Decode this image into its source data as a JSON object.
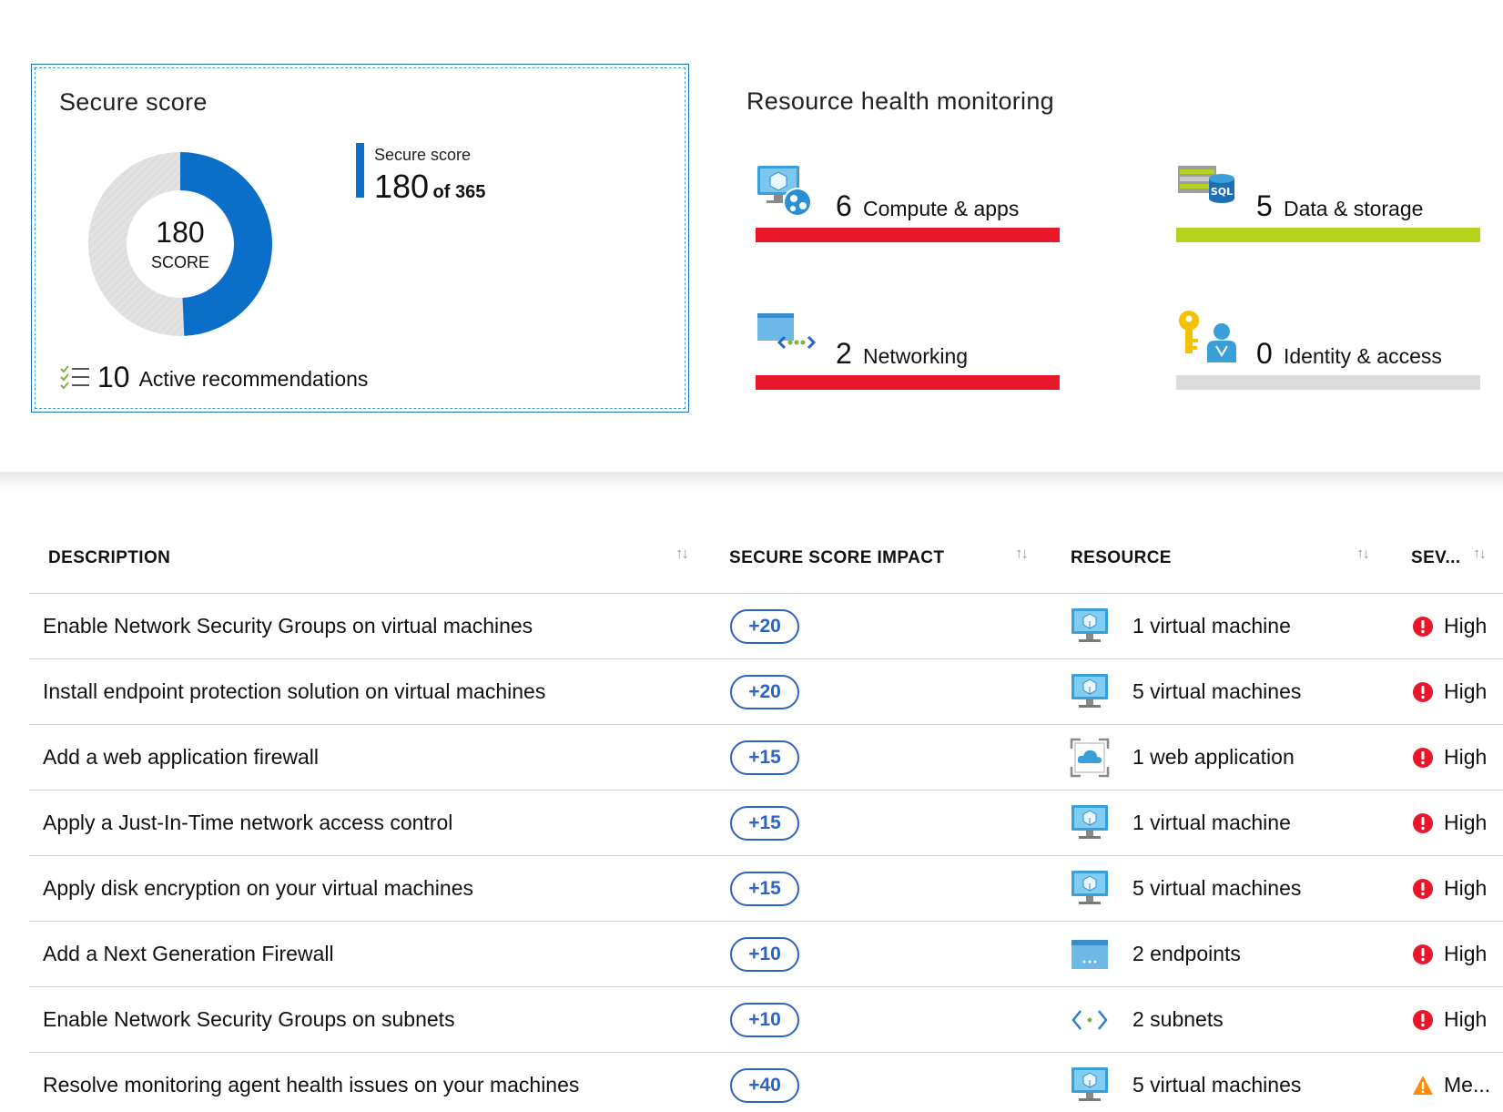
{
  "secure_score": {
    "title": "Secure score",
    "score": "180",
    "score_caption": "SCORE",
    "score_value": 180,
    "score_max": 365,
    "legend_label": "Secure score",
    "legend_value": "180",
    "legend_of": "of 365",
    "active_count": "10",
    "active_label": "Active recommendations",
    "colors": {
      "score": "#0b6ec9",
      "remaining": "#dadada"
    }
  },
  "resource_health": {
    "title": "Resource health monitoring",
    "tiles": [
      {
        "count": "6",
        "label": "Compute & apps",
        "bar_color": "#e8182a",
        "icon": "compute-apps-icon"
      },
      {
        "count": "5",
        "label": "Data & storage",
        "bar_color": "#b6d21c",
        "icon": "data-storage-icon"
      },
      {
        "count": "2",
        "label": "Networking",
        "bar_color": "#e8182a",
        "icon": "networking-icon"
      },
      {
        "count": "0",
        "label": "Identity & access",
        "bar_color": "#dcdcdc",
        "icon": "identity-access-icon"
      }
    ]
  },
  "table": {
    "headers": {
      "description": "DESCRIPTION",
      "impact": "SECURE SCORE IMPACT",
      "resource": "RESOURCE",
      "severity": "SEV..."
    },
    "rows": [
      {
        "description": "Enable Network Security Groups on virtual machines",
        "impact": "+20",
        "resource": "1 virtual machine",
        "resource_icon": "virtual-machine-icon",
        "severity": "High",
        "severity_icon": "high-severity-icon"
      },
      {
        "description": "Install endpoint protection solution on virtual machines",
        "impact": "+20",
        "resource": "5 virtual machines",
        "resource_icon": "virtual-machine-icon",
        "severity": "High",
        "severity_icon": "high-severity-icon"
      },
      {
        "description": "Add a web application firewall",
        "impact": "+15",
        "resource": "1 web application",
        "resource_icon": "web-application-icon",
        "severity": "High",
        "severity_icon": "high-severity-icon"
      },
      {
        "description": "Apply a Just-In-Time network access control",
        "impact": "+15",
        "resource": "1 virtual machine",
        "resource_icon": "virtual-machine-icon",
        "severity": "High",
        "severity_icon": "high-severity-icon"
      },
      {
        "description": "Apply disk encryption on your virtual machines",
        "impact": "+15",
        "resource": "5 virtual machines",
        "resource_icon": "virtual-machine-icon",
        "severity": "High",
        "severity_icon": "high-severity-icon"
      },
      {
        "description": "Add a Next Generation Firewall",
        "impact": "+10",
        "resource": "2 endpoints",
        "resource_icon": "endpoint-icon",
        "severity": "High",
        "severity_icon": "high-severity-icon"
      },
      {
        "description": "Enable Network Security Groups on subnets",
        "impact": "+10",
        "resource": "2 subnets",
        "resource_icon": "subnet-icon",
        "severity": "High",
        "severity_icon": "high-severity-icon"
      },
      {
        "description": "Resolve monitoring agent health issues on your machines",
        "impact": "+40",
        "resource": "5 virtual machines",
        "resource_icon": "virtual-machine-icon",
        "severity": "Me...",
        "severity_icon": "medium-severity-icon"
      }
    ]
  }
}
